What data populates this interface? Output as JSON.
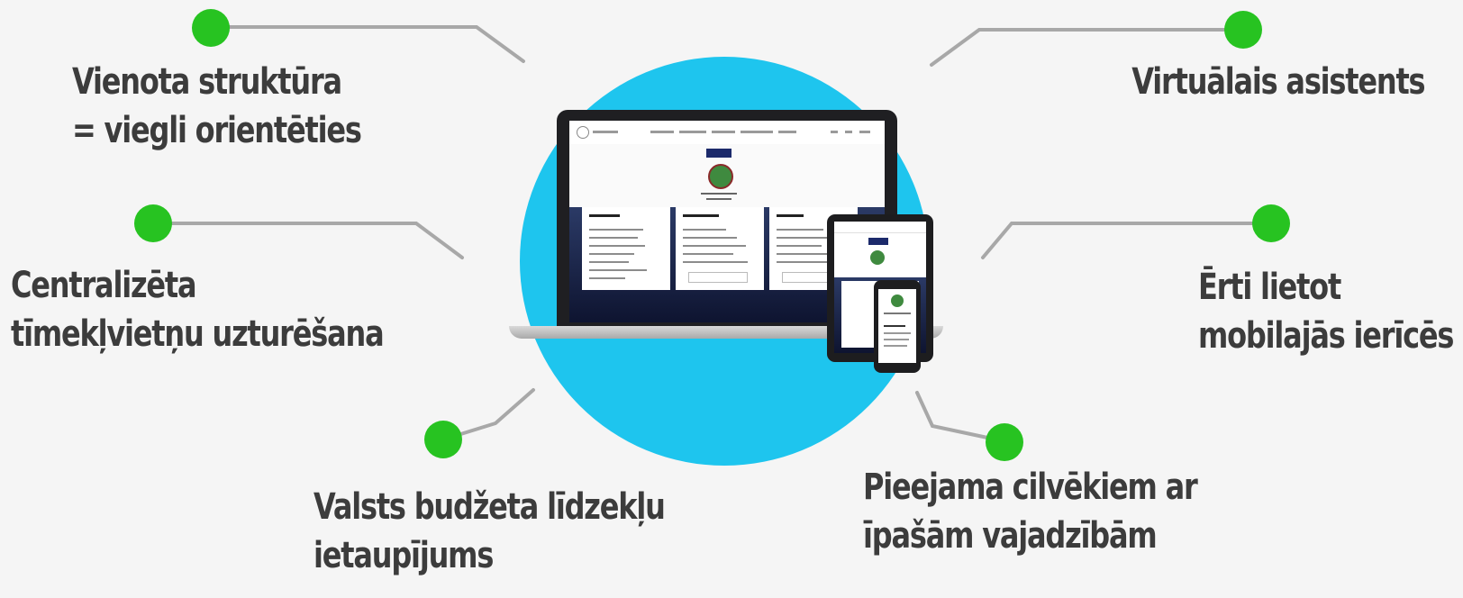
{
  "labels": {
    "unified_structure": [
      "Vienota struktūra",
      "= viegli orientēties"
    ],
    "centralized": [
      "Centralizēta",
      "tīmekļvietņu uzturēšana"
    ],
    "budget": [
      "Valsts budžeta līdzekļu",
      "ietaupījums"
    ],
    "assistant": [
      "Virtuālais asistents"
    ],
    "mobile": [
      "Ērti lietot",
      "mobilajās ierīcēs"
    ],
    "accessible": [
      "Pieejama cilvēkiem ar",
      "īpašām vajadzībām"
    ]
  },
  "colors": {
    "background": "#f5f5f5",
    "circle": "#1ec5ee",
    "dot": "#27c321",
    "connector": "#a8a8a8",
    "text": "#3c3c3c"
  },
  "icons": [
    "laptop-icon",
    "tablet-icon",
    "phone-icon"
  ]
}
